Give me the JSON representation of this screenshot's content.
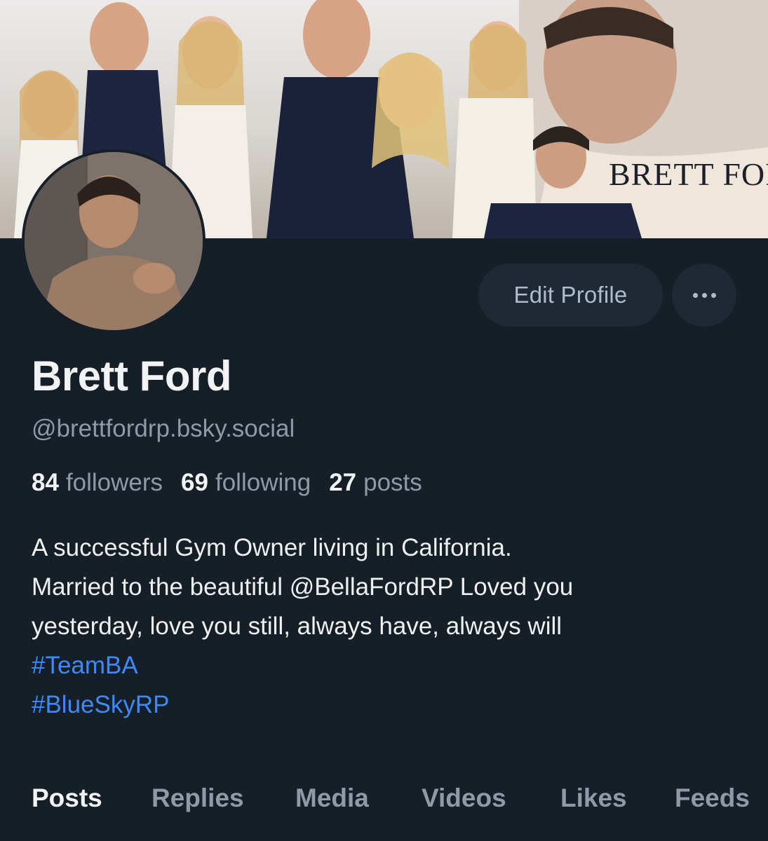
{
  "banner": {
    "title": "BRETT FORD"
  },
  "actions": {
    "edit_profile_label": "Edit Profile",
    "more_icon": "ellipsis-icon"
  },
  "profile": {
    "display_name": "Brett Ford",
    "handle": "@brettfordrp.bsky.social",
    "stats": {
      "followers_count": "84",
      "followers_label": "followers",
      "following_count": "69",
      "following_label": "following",
      "posts_count": "27",
      "posts_label": "posts"
    },
    "bio": {
      "line1": "A successful Gym Owner living in California.",
      "line2": "Married to the beautiful @BellaFordRP Loved you",
      "line3": "yesterday, love you still, always have, always will",
      "hashtag1": "#TeamBA",
      "hashtag2": "#BlueSkyRP"
    }
  },
  "tabs": [
    {
      "label": "Posts",
      "active": true
    },
    {
      "label": "Replies",
      "active": false
    },
    {
      "label": "Media",
      "active": false
    },
    {
      "label": "Videos",
      "active": false
    },
    {
      "label": "Likes",
      "active": false
    },
    {
      "label": "Feeds",
      "active": false
    }
  ],
  "colors": {
    "background": "#161e27",
    "button_bg": "#1e2935",
    "muted_text": "#8d9aa8",
    "link": "#3d8af7"
  }
}
